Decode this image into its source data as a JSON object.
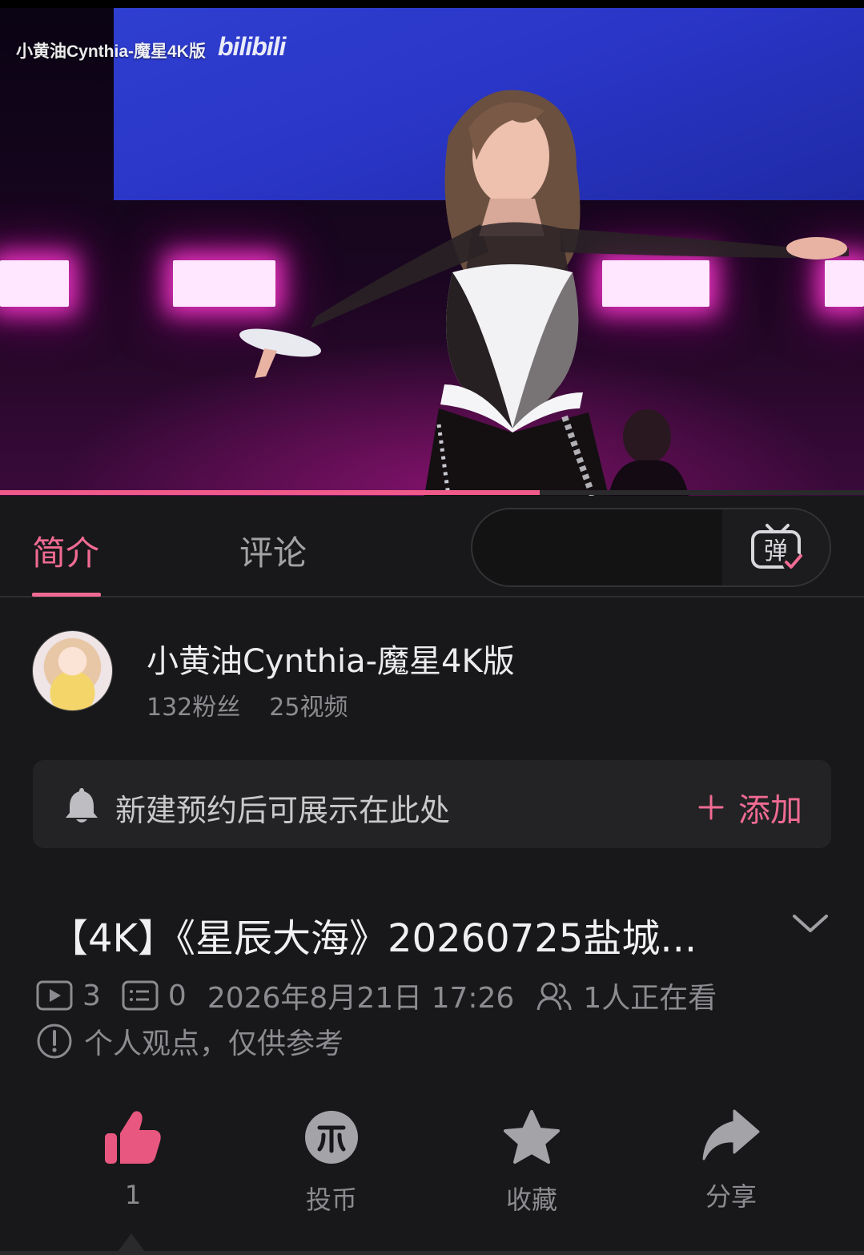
{
  "player": {
    "watermark_title": "小黄油Cynthia-魔星4K版",
    "watermark_logo": "bilibili",
    "progress_fraction": 0.625,
    "accent": "#f05a8a"
  },
  "tabs": [
    {
      "label": "简介",
      "active": true
    },
    {
      "label": "评论",
      "active": false
    }
  ],
  "danmaku": {
    "placeholder": "",
    "toggle_icon": "danmaku-toggle-icon",
    "toggle_glyph": "弹"
  },
  "uploader": {
    "name": "小黄油Cynthia-魔星4K版",
    "fans": "132粉丝",
    "videos": "25视频"
  },
  "reservation": {
    "icon": "bell-icon",
    "text": "新建预约后可展示在此处",
    "add_label": "添加"
  },
  "video": {
    "title": "【4K】《星辰大海》20260725盐城...",
    "plays": "3",
    "danmaku_count": "0",
    "publish_time": "2026年8月21日 17:26",
    "watching": "1人正在看",
    "notice": "个人观点，仅供参考"
  },
  "actions": {
    "like": {
      "icon": "thumbs-up-icon",
      "label": "1",
      "color": "#e8577f"
    },
    "coin": {
      "icon": "coin-icon",
      "label": "投币"
    },
    "favorite": {
      "icon": "star-icon",
      "label": "收藏"
    },
    "share": {
      "icon": "share-arrow-icon",
      "label": "分享"
    }
  }
}
